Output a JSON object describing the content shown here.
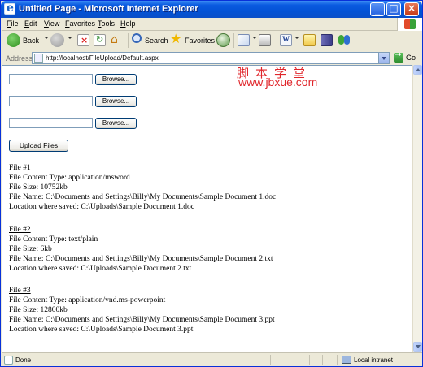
{
  "window": {
    "title": "Untitled Page - Microsoft Internet Explorer"
  },
  "menu": [
    "File",
    "Edit",
    "View",
    "Favorites",
    "Tools",
    "Help"
  ],
  "toolbar": {
    "back_label": "Back",
    "search_label": "Search",
    "favorites_label": "Favorites"
  },
  "address": {
    "label": "Address",
    "url": "http://localhost/FileUpload/Default.aspx",
    "go_label": "Go"
  },
  "form": {
    "browse_label": "Browse...",
    "upload_label": "Upload Files"
  },
  "watermark": {
    "chinese": "脚本学堂",
    "url": "www.jbxue.com"
  },
  "files": [
    {
      "heading": "File #1",
      "content_type": "File Content Type: application/msword",
      "size": "File Size: 10752kb",
      "name": "File Name: C:\\Documents and Settings\\Billy\\My Documents\\Sample Document 1.doc",
      "saved": "Location where saved: C:\\Uploads\\Sample Document 1.doc"
    },
    {
      "heading": "File #2",
      "content_type": "File Content Type: text/plain",
      "size": "File Size: 6kb",
      "name": "File Name: C:\\Documents and Settings\\Billy\\My Documents\\Sample Document 2.txt",
      "saved": "Location where saved: C:\\Uploads\\Sample Document 2.txt"
    },
    {
      "heading": "File #3",
      "content_type": "File Content Type: application/vnd.ms-powerpoint",
      "size": "File Size: 12800kb",
      "name": "File Name: C:\\Documents and Settings\\Billy\\My Documents\\Sample Document 3.ppt",
      "saved": "Location where saved: C:\\Uploads\\Sample Document 3.ppt"
    }
  ],
  "status": {
    "text": "Done",
    "zone": "Local intranet"
  }
}
